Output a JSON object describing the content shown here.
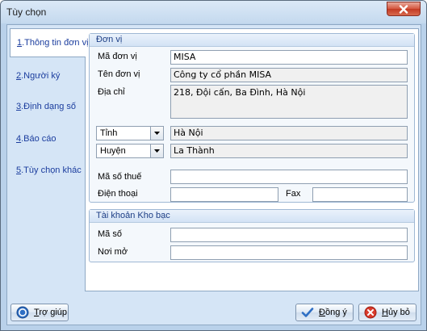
{
  "window": {
    "title": "Tùy chọn"
  },
  "tabs": [
    {
      "num": "1",
      "label": ".Thông tin đơn vị"
    },
    {
      "num": "2",
      "label": ".Người ký"
    },
    {
      "num": "3",
      "label": ".Định dạng số"
    },
    {
      "num": "4",
      "label": ".Báo cáo"
    },
    {
      "num": "5",
      "label": ".Tùy chọn khác"
    }
  ],
  "unit_group": {
    "title": "Đơn vị",
    "ma_don_vi_label": "Mã đơn vị",
    "ma_don_vi_value": "MISA",
    "ten_don_vi_label": "Tên đơn vị",
    "ten_don_vi_value": "Công ty cổ phần MISA",
    "dia_chi_label": "Địa chỉ",
    "dia_chi_value": "218, Đội cấn, Ba Đình, Hà Nội",
    "tinh_option": "Tỉnh",
    "tinh_value": "Hà Nội",
    "huyen_option": "Huyện",
    "huyen_value": "La Thành",
    "ma_so_thue_label": "Mã số thuế",
    "ma_so_thue_value": "",
    "dien_thoai_label": "Điện thoại",
    "dien_thoai_value": "",
    "fax_label": "Fax",
    "fax_value": ""
  },
  "treasury_group": {
    "title": "Tài khoản Kho bạc",
    "ma_so_label": "Mã số",
    "ma_so_value": "",
    "noi_mo_label": "Nơi mở",
    "noi_mo_value": ""
  },
  "buttons": {
    "help_u": "T",
    "help_rest": "rợ giúp",
    "ok_u": "Đ",
    "ok_rest": "ồng ý",
    "cancel_u": "H",
    "cancel_rest": "ủy bỏ"
  },
  "icons": {
    "close": "close-icon",
    "help": "help-icon",
    "ok": "checkmark-icon",
    "cancel": "cancel-icon"
  }
}
